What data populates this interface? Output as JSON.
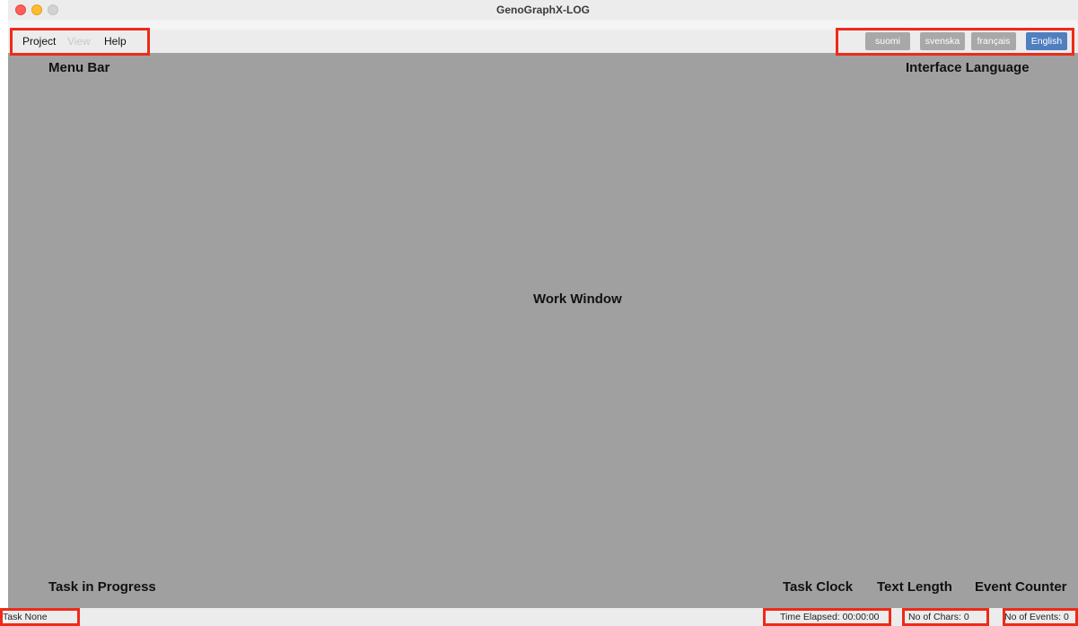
{
  "window": {
    "title": "GenoGraphX-LOG"
  },
  "menu": {
    "items": [
      {
        "label": "Project",
        "enabled": true
      },
      {
        "label": "View",
        "enabled": false
      },
      {
        "label": "Help",
        "enabled": true
      }
    ]
  },
  "languages": {
    "buttons": [
      "suomi",
      "svenska",
      "français",
      "English"
    ],
    "active": "English"
  },
  "annotations": {
    "menu_bar": "Menu Bar",
    "interface_language": "Interface Language",
    "work_window": "Work Window",
    "task_in_progress": "Task in Progress",
    "task_clock": "Task Clock",
    "text_length": "Text Length",
    "event_counter": "Event Counter"
  },
  "status": {
    "task": "Task  None",
    "time_elapsed": "Time Elapsed:  00:00:00",
    "chars": "No of Chars:  0",
    "events": "No of Events:  0"
  },
  "colors": {
    "work_area": "#a0a0a0",
    "highlight": "#ee2a1a",
    "active_language": "#4f7fbf"
  }
}
